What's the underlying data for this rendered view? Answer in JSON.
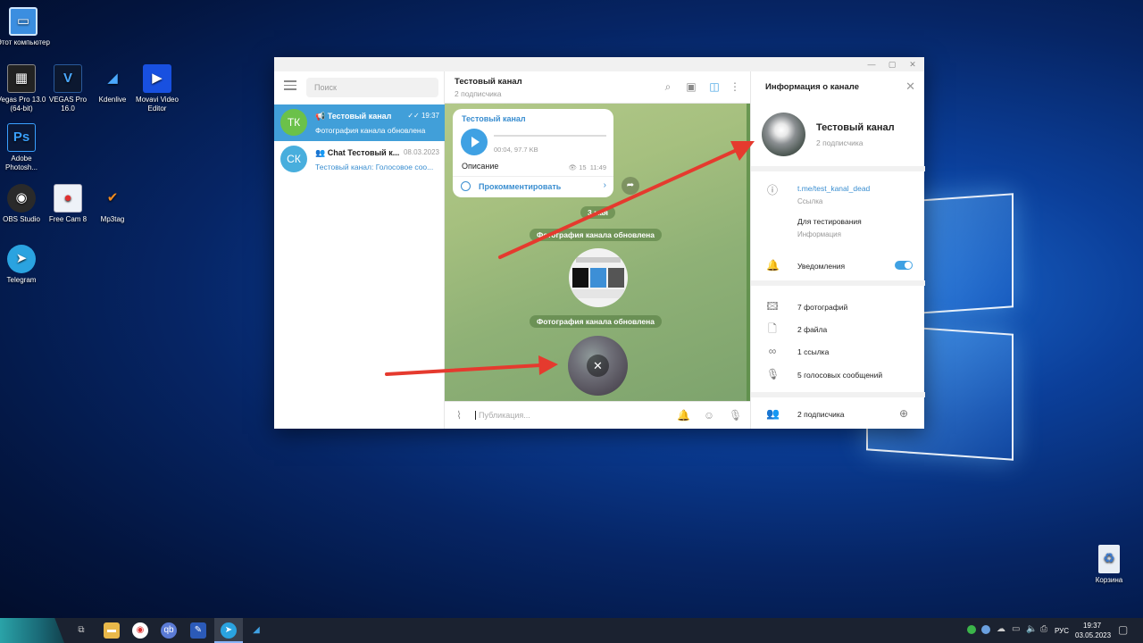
{
  "desktop": {
    "icons": [
      {
        "label": "Этот компьютер"
      },
      {
        "label": "Vegas Pro 13.0 (64-bit)"
      },
      {
        "label": "VEGAS Pro 16.0"
      },
      {
        "label": "Kdenlive"
      },
      {
        "label": "Movavi Video Editor"
      },
      {
        "label": "Adobe Photosh..."
      },
      {
        "label": "OBS Studio"
      },
      {
        "label": "Free Cam 8"
      },
      {
        "label": "Mp3tag"
      },
      {
        "label": "Telegram"
      },
      {
        "label": "Корзина"
      }
    ]
  },
  "telegram": {
    "search_placeholder": "Поиск",
    "chats": [
      {
        "initials": "ТК",
        "name": "Тестовый канал",
        "time": "19:37",
        "preview": "Фотография канала обновлена",
        "color": "#6bc14a"
      },
      {
        "initials": "СК",
        "name": "Chat Тестовый к...",
        "time": "08.03.2023",
        "preview": "Тестовый канал: Голосовое соо...",
        "color": "#48aedd"
      }
    ],
    "header": {
      "title": "Тестовый канал",
      "subtitle": "2 подписчика"
    },
    "message": {
      "channel": "Тестовый канал",
      "duration": "00:04, 97.7 KB",
      "description": "Описание",
      "views": "15",
      "time": "11:49",
      "comment": "Прокомментировать"
    },
    "date_pill": "3 мая",
    "service_1": "Фотография канала обновлена",
    "service_2": "Фотография канала обновлена",
    "composer_placeholder": "Публикация...",
    "info": {
      "title": "Информация о канале",
      "name": "Тестовый канал",
      "subscribers": "2 подписчика",
      "link": "t.me/test_kanal_dead",
      "link_caption": "Ссылка",
      "about": "Для тестирования",
      "about_caption": "Информация",
      "notifications": "Уведомления",
      "media": [
        "7 фотографий",
        "2 файла",
        "1 ссылка",
        "5 голосовых сообщений"
      ],
      "members": "2 подписчика"
    }
  },
  "taskbar": {
    "lang": "РУС",
    "time": "19:37",
    "date": "03.05.2023"
  },
  "colors": {
    "accent": "#3fa1e3",
    "selected": "#419fd9",
    "arrow": "#e53a2e"
  }
}
